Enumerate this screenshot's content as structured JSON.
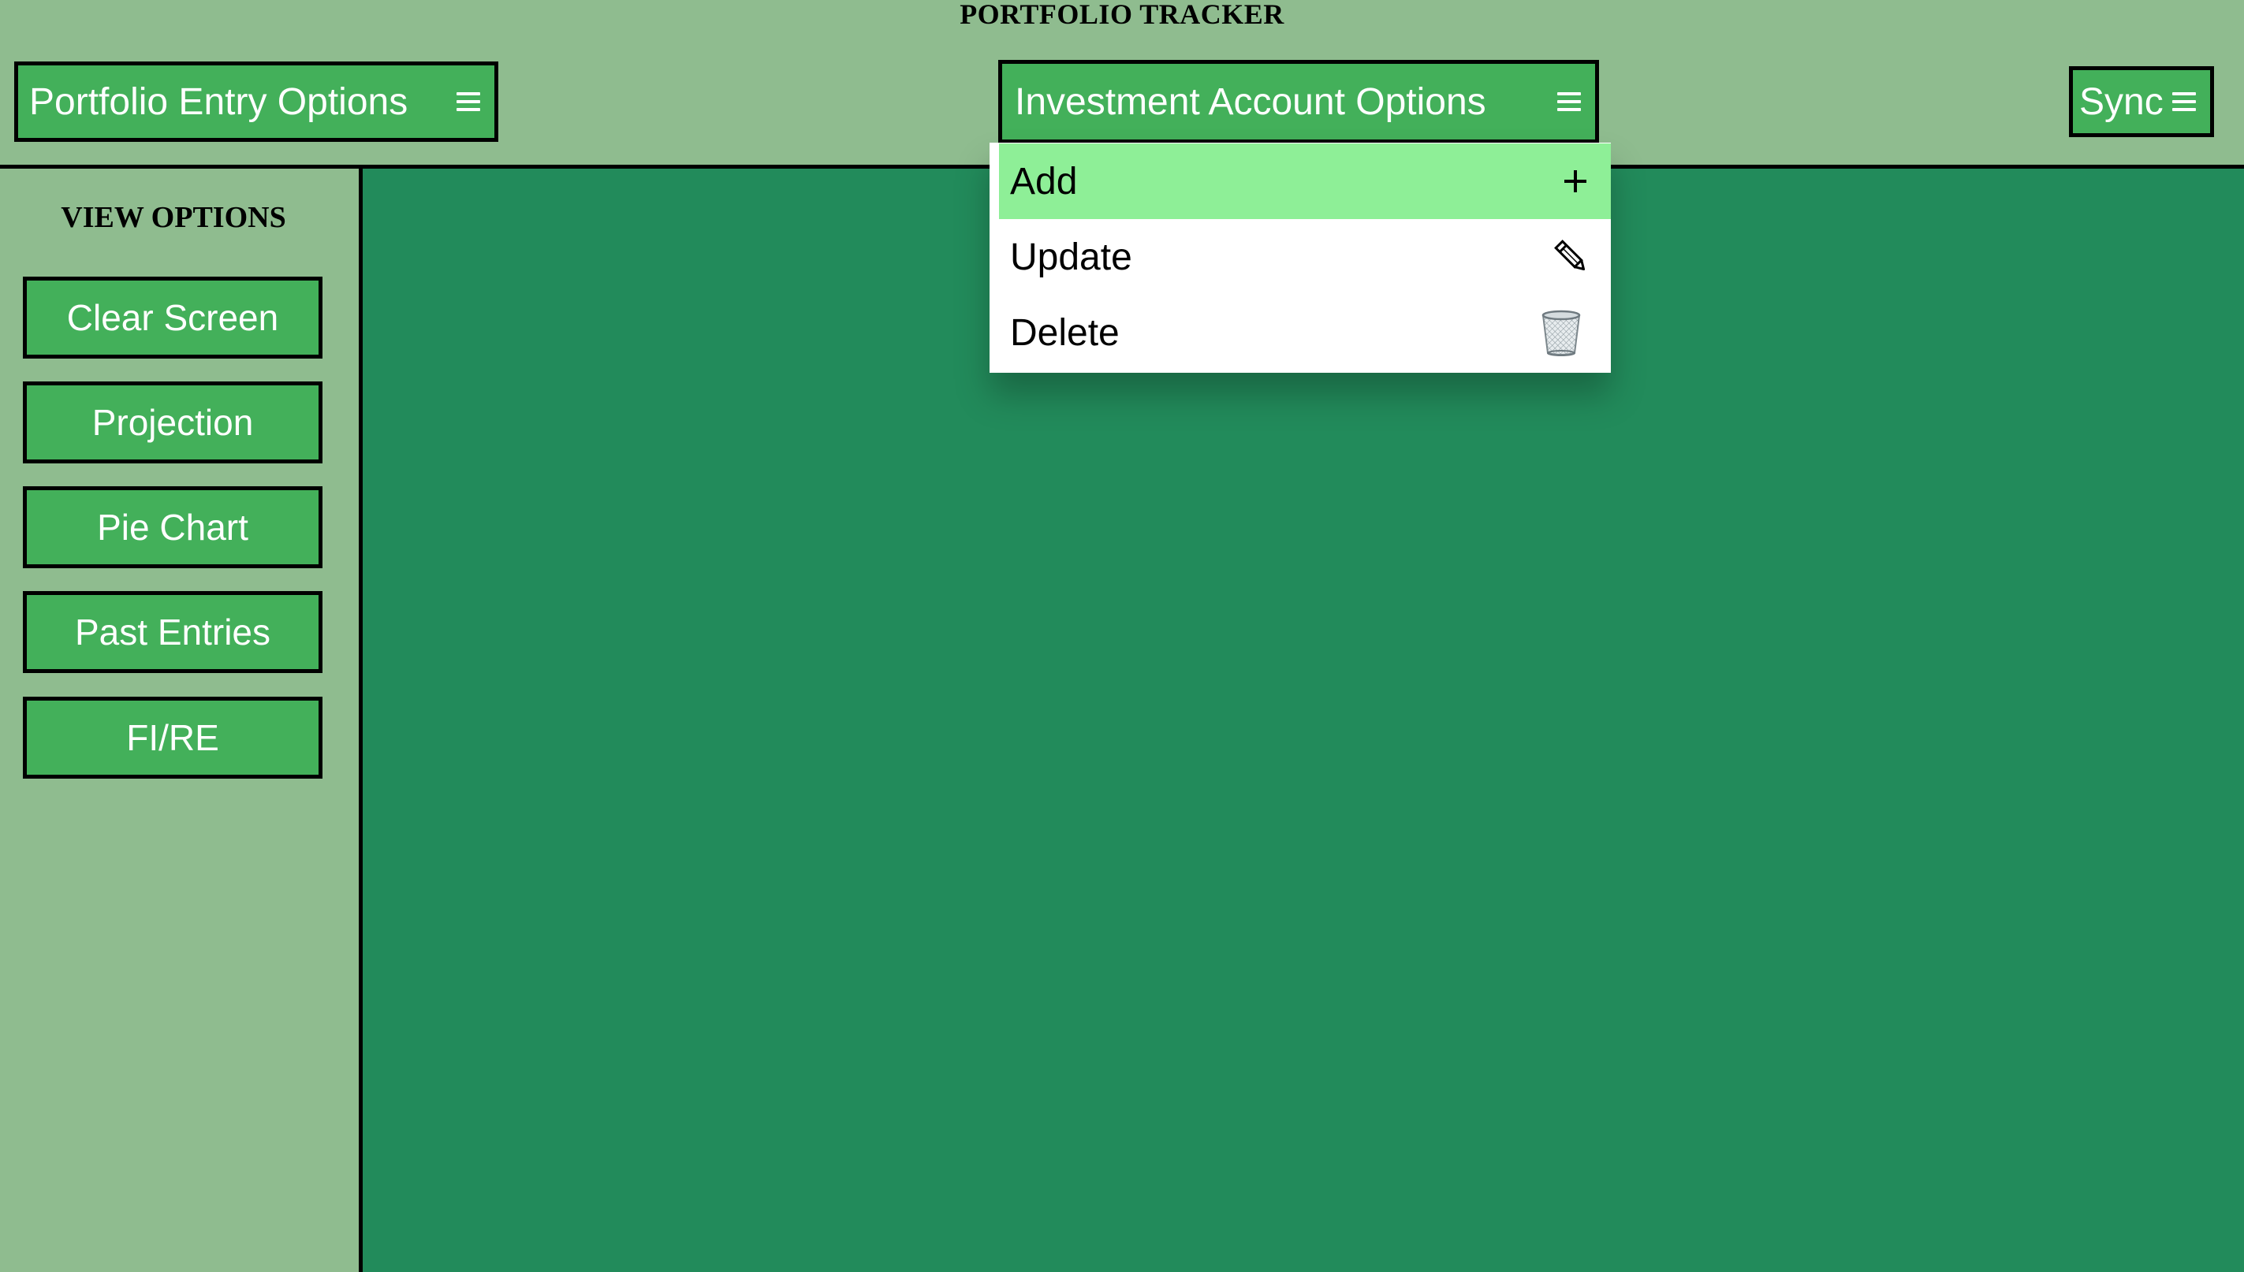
{
  "app": {
    "title": "PORTFOLIO TRACKER"
  },
  "header": {
    "portfolio_menu": {
      "label": "Portfolio Entry Options",
      "icon": "hamburger-icon"
    },
    "investment_menu": {
      "label": "Investment Account Options",
      "icon": "hamburger-icon"
    },
    "sync_menu": {
      "label": "Sync",
      "icon": "hamburger-icon"
    }
  },
  "sidebar": {
    "title": "VIEW OPTIONS",
    "items": [
      {
        "label": "Clear Screen"
      },
      {
        "label": "Projection"
      },
      {
        "label": "Pie Chart"
      },
      {
        "label": "Past Entries"
      },
      {
        "label": "FI/RE"
      }
    ]
  },
  "dropdown": {
    "items": [
      {
        "label": "Add",
        "icon": "plus-icon",
        "highlighted": true
      },
      {
        "label": "Update",
        "icon": "pencil-icon",
        "highlighted": false
      },
      {
        "label": "Delete",
        "icon": "wastebasket-icon",
        "highlighted": false
      }
    ]
  },
  "colors": {
    "page_background": "#8fbc8f",
    "button_green": "#43b05a",
    "main_panel": "#228b5b",
    "dropdown_highlight": "#8eef97",
    "border": "#000000"
  }
}
